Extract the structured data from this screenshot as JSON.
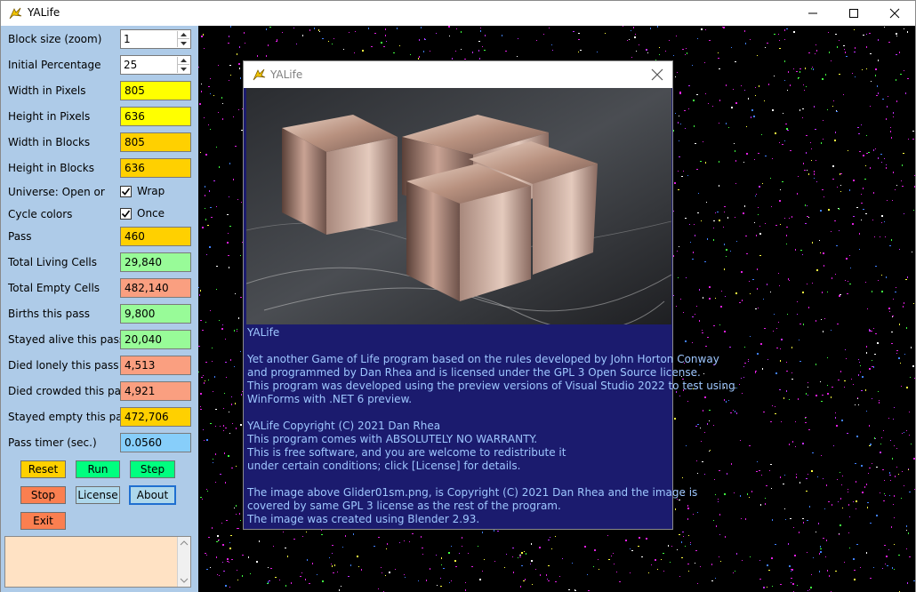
{
  "window": {
    "title": "YALife",
    "minimize_icon": "minimize-icon",
    "maximize_icon": "maximize-icon",
    "close_icon": "close-icon"
  },
  "colors": {
    "panel": "#aecbe8",
    "yellow": "#ffff00",
    "gold": "#ffd000",
    "green": "#98fb98",
    "salmon": "#fa9f80",
    "sky": "#87cefa",
    "log": "#ffe2c4",
    "dialog": "#1b1b6e",
    "dialog_text": "#9ec7ff",
    "live_cells": "#e020e0"
  },
  "settings": {
    "block_size": {
      "label": "Block size (zoom)",
      "value": "1"
    },
    "initial_percentage": {
      "label": "Initial Percentage",
      "value": "25"
    },
    "width_pixels": {
      "label": "Width in Pixels",
      "value": "805"
    },
    "height_pixels": {
      "label": "Height in Pixels",
      "value": "636"
    },
    "width_blocks": {
      "label": "Width in Blocks",
      "value": "805"
    },
    "height_blocks": {
      "label": "Height in Blocks",
      "value": "636"
    },
    "universe": {
      "label": "Universe: Open or",
      "checkbox_label": "Wrap",
      "checked": true
    },
    "cycle_colors": {
      "label": "Cycle colors",
      "checkbox_label": "Once",
      "checked": true
    }
  },
  "stats": {
    "pass": {
      "label": "Pass",
      "value": "460"
    },
    "total_living": {
      "label": "Total Living Cells",
      "value": "29,840"
    },
    "total_empty": {
      "label": "Total Empty Cells",
      "value": "482,140"
    },
    "births": {
      "label": "Births this pass",
      "value": "9,800"
    },
    "stayed_alive": {
      "label": "Stayed alive this pass",
      "value": "20,040"
    },
    "died_lonely": {
      "label": "Died lonely this pass",
      "value": "4,513"
    },
    "died_crowded": {
      "label": "Died crowded this pass",
      "value": "4,921"
    },
    "stayed_empty": {
      "label": "Stayed empty this pass",
      "value": "472,706"
    },
    "pass_timer": {
      "label": "Pass timer (sec.)",
      "value": "0.0560"
    }
  },
  "buttons": {
    "reset": "Reset",
    "run": "Run",
    "step": "Step",
    "stop": "Stop",
    "license": "License",
    "about": "About",
    "exit": "Exit"
  },
  "log": {
    "text": ""
  },
  "dialog": {
    "title": "YALife",
    "close_icon": "close-icon",
    "image_alt": "rendered metal cubes glider",
    "lines": [
      "YALife",
      "",
      "Yet another Game of Life program based on the rules developed by John Horton Conway",
      "and programmed by Dan Rhea and is licensed under the GPL 3 Open Source license.",
      "This program was developed using the preview versions of Visual Studio 2022 to test using",
      "WinForms with .NET 6 preview.",
      "",
      "YALife  Copyright (C) 2021  Dan Rhea",
      "This program comes with ABSOLUTELY NO WARRANTY.",
      "This is free software, and you are welcome to redistribute it",
      "under certain conditions; click [License] for details.",
      "",
      "The image above Glider01sm.png, is Copyright (C) 2021 Dan Rhea and the image is",
      "covered by same GPL 3 license as the rest of the program.",
      "The image was created using Blender 2.93."
    ]
  }
}
